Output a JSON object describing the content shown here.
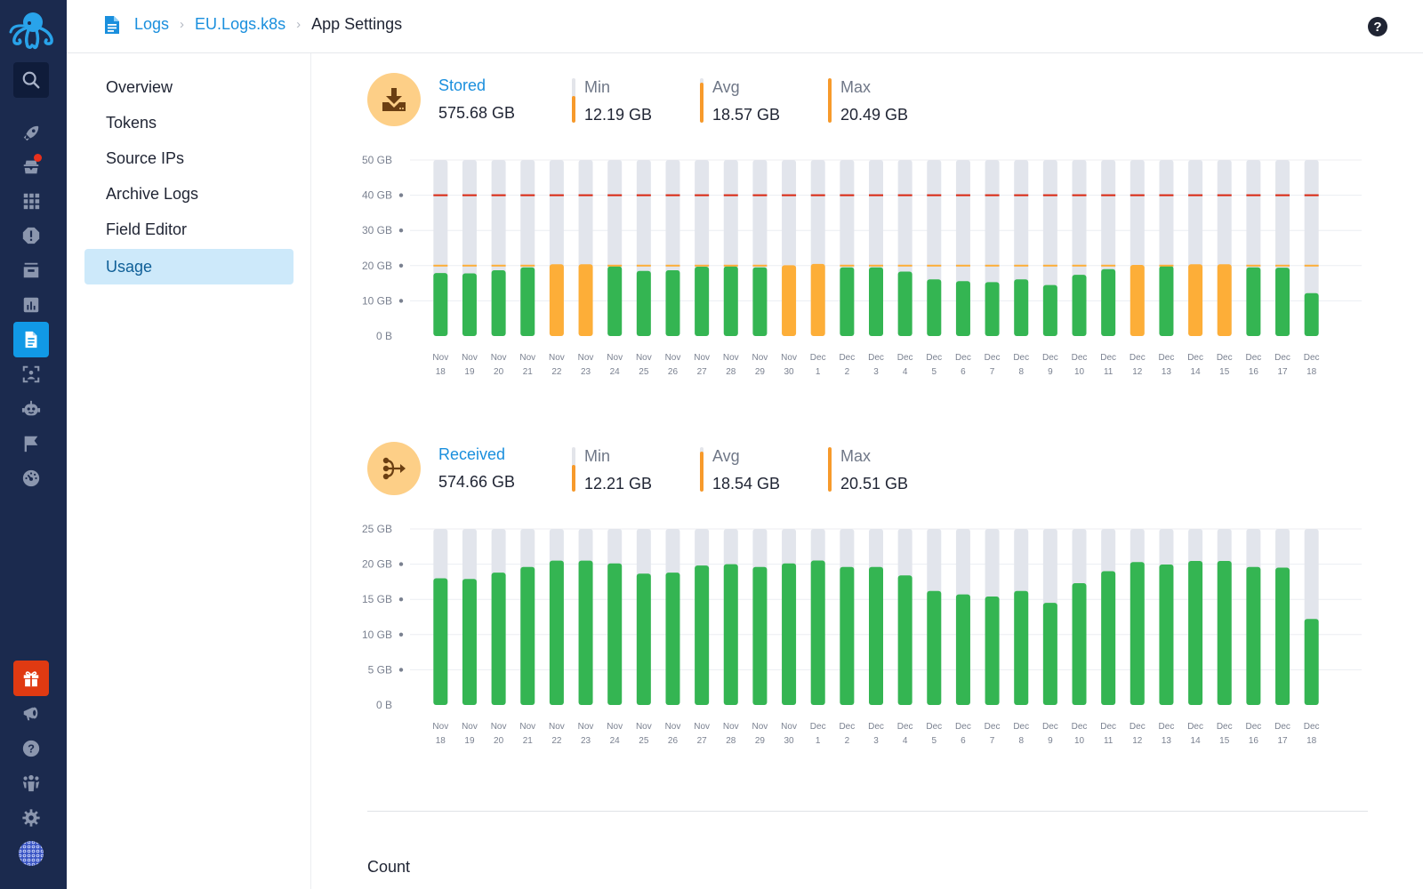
{
  "breadcrumb": {
    "items": [
      "Logs",
      "EU.Logs.k8s"
    ],
    "current": "App Settings"
  },
  "header": {
    "help_icon": "question-circle-icon"
  },
  "rail": {
    "icons": [
      "logo-octopus",
      "search-icon",
      "rocket-icon",
      "spy-icon",
      "apps-grid-icon",
      "alert-icon",
      "archive-icon",
      "chart-icon",
      "logs-document-icon",
      "user-scan-icon",
      "robot-icon",
      "flag-icon",
      "dashboard-gauge-icon",
      "gift-icon",
      "megaphone-icon",
      "help-icon",
      "team-icon",
      "settings-gear-icon",
      "avatar-globe"
    ],
    "active": "logs-document-icon",
    "notification_on": "spy-icon"
  },
  "subnav": {
    "items": [
      {
        "label": "Overview"
      },
      {
        "label": "Tokens"
      },
      {
        "label": "Source IPs"
      },
      {
        "label": "Archive Logs"
      },
      {
        "label": "Field Editor"
      },
      {
        "label": "Usage"
      }
    ],
    "active_index": 5
  },
  "stored": {
    "label": "Stored",
    "total": "575.68 GB",
    "min_label": "Min",
    "min": "12.19 GB",
    "min_fill": 0.6,
    "avg_label": "Avg",
    "avg": "18.57 GB",
    "avg_fill": 0.9,
    "max_label": "Max",
    "max": "20.49 GB",
    "max_fill": 1.0
  },
  "received": {
    "label": "Received",
    "total": "574.66 GB",
    "min_label": "Min",
    "min": "12.21 GB",
    "min_fill": 0.6,
    "avg_label": "Avg",
    "avg": "18.54 GB",
    "avg_fill": 0.9,
    "max_label": "Max",
    "max": "20.51 GB",
    "max_fill": 1.0
  },
  "colors": {
    "normal_bar": "#34b552",
    "warning_bar": "#fdae38",
    "track": "#e2e5ec",
    "warning_line": "#fdae38",
    "limit_line": "#d9260f",
    "accent": "#1a8fdd"
  },
  "chart_data": [
    {
      "type": "bar",
      "title": "Stored",
      "xlabel": "",
      "ylabel": "",
      "ylim": [
        0,
        50
      ],
      "y_ticks": [
        "0 B",
        "10 GB",
        "20 GB",
        "30 GB",
        "40 GB",
        "50 GB"
      ],
      "y_tick_values": [
        0,
        10,
        20,
        30,
        40,
        50
      ],
      "grid": true,
      "warning_threshold": 20,
      "limit_threshold": 40,
      "categories": [
        [
          "Nov",
          "18"
        ],
        [
          "Nov",
          "19"
        ],
        [
          "Nov",
          "20"
        ],
        [
          "Nov",
          "21"
        ],
        [
          "Nov",
          "22"
        ],
        [
          "Nov",
          "23"
        ],
        [
          "Nov",
          "24"
        ],
        [
          "Nov",
          "25"
        ],
        [
          "Nov",
          "26"
        ],
        [
          "Nov",
          "27"
        ],
        [
          "Nov",
          "28"
        ],
        [
          "Nov",
          "29"
        ],
        [
          "Nov",
          "30"
        ],
        [
          "Dec",
          "1"
        ],
        [
          "Dec",
          "2"
        ],
        [
          "Dec",
          "3"
        ],
        [
          "Dec",
          "4"
        ],
        [
          "Dec",
          "5"
        ],
        [
          "Dec",
          "6"
        ],
        [
          "Dec",
          "7"
        ],
        [
          "Dec",
          "8"
        ],
        [
          "Dec",
          "9"
        ],
        [
          "Dec",
          "10"
        ],
        [
          "Dec",
          "11"
        ],
        [
          "Dec",
          "12"
        ],
        [
          "Dec",
          "13"
        ],
        [
          "Dec",
          "14"
        ],
        [
          "Dec",
          "15"
        ],
        [
          "Dec",
          "16"
        ],
        [
          "Dec",
          "17"
        ],
        [
          "Dec",
          "18"
        ]
      ],
      "values": [
        17.9,
        17.8,
        18.7,
        19.5,
        20.4,
        20.4,
        19.8,
        18.5,
        18.7,
        19.7,
        19.8,
        19.5,
        20.1,
        20.49,
        19.5,
        19.5,
        18.3,
        16.1,
        15.6,
        15.3,
        16.1,
        14.5,
        17.4,
        19.0,
        20.2,
        19.9,
        20.4,
        20.4,
        19.5,
        19.4,
        12.19
      ]
    },
    {
      "type": "bar",
      "title": "Received",
      "xlabel": "",
      "ylabel": "",
      "ylim": [
        0,
        25
      ],
      "y_ticks": [
        "0 B",
        "5 GB",
        "10 GB",
        "15 GB",
        "20 GB",
        "25 GB"
      ],
      "y_tick_values": [
        0,
        5,
        10,
        15,
        20,
        25
      ],
      "grid": true,
      "categories": [
        [
          "Nov",
          "18"
        ],
        [
          "Nov",
          "19"
        ],
        [
          "Nov",
          "20"
        ],
        [
          "Nov",
          "21"
        ],
        [
          "Nov",
          "22"
        ],
        [
          "Nov",
          "23"
        ],
        [
          "Nov",
          "24"
        ],
        [
          "Nov",
          "25"
        ],
        [
          "Nov",
          "26"
        ],
        [
          "Nov",
          "27"
        ],
        [
          "Nov",
          "28"
        ],
        [
          "Nov",
          "29"
        ],
        [
          "Nov",
          "30"
        ],
        [
          "Dec",
          "1"
        ],
        [
          "Dec",
          "2"
        ],
        [
          "Dec",
          "3"
        ],
        [
          "Dec",
          "4"
        ],
        [
          "Dec",
          "5"
        ],
        [
          "Dec",
          "6"
        ],
        [
          "Dec",
          "7"
        ],
        [
          "Dec",
          "8"
        ],
        [
          "Dec",
          "9"
        ],
        [
          "Dec",
          "10"
        ],
        [
          "Dec",
          "11"
        ],
        [
          "Dec",
          "12"
        ],
        [
          "Dec",
          "13"
        ],
        [
          "Dec",
          "14"
        ],
        [
          "Dec",
          "15"
        ],
        [
          "Dec",
          "16"
        ],
        [
          "Dec",
          "17"
        ],
        [
          "Dec",
          "18"
        ]
      ],
      "values": [
        18.0,
        17.9,
        18.8,
        19.6,
        20.5,
        20.5,
        20.1,
        18.65,
        18.8,
        19.8,
        20.0,
        19.6,
        20.1,
        20.51,
        19.6,
        19.6,
        18.4,
        16.2,
        15.7,
        15.4,
        16.2,
        14.5,
        17.3,
        19.0,
        20.3,
        19.95,
        20.45,
        20.45,
        19.6,
        19.5,
        12.21
      ]
    }
  ],
  "count_section": {
    "title": "Count"
  }
}
